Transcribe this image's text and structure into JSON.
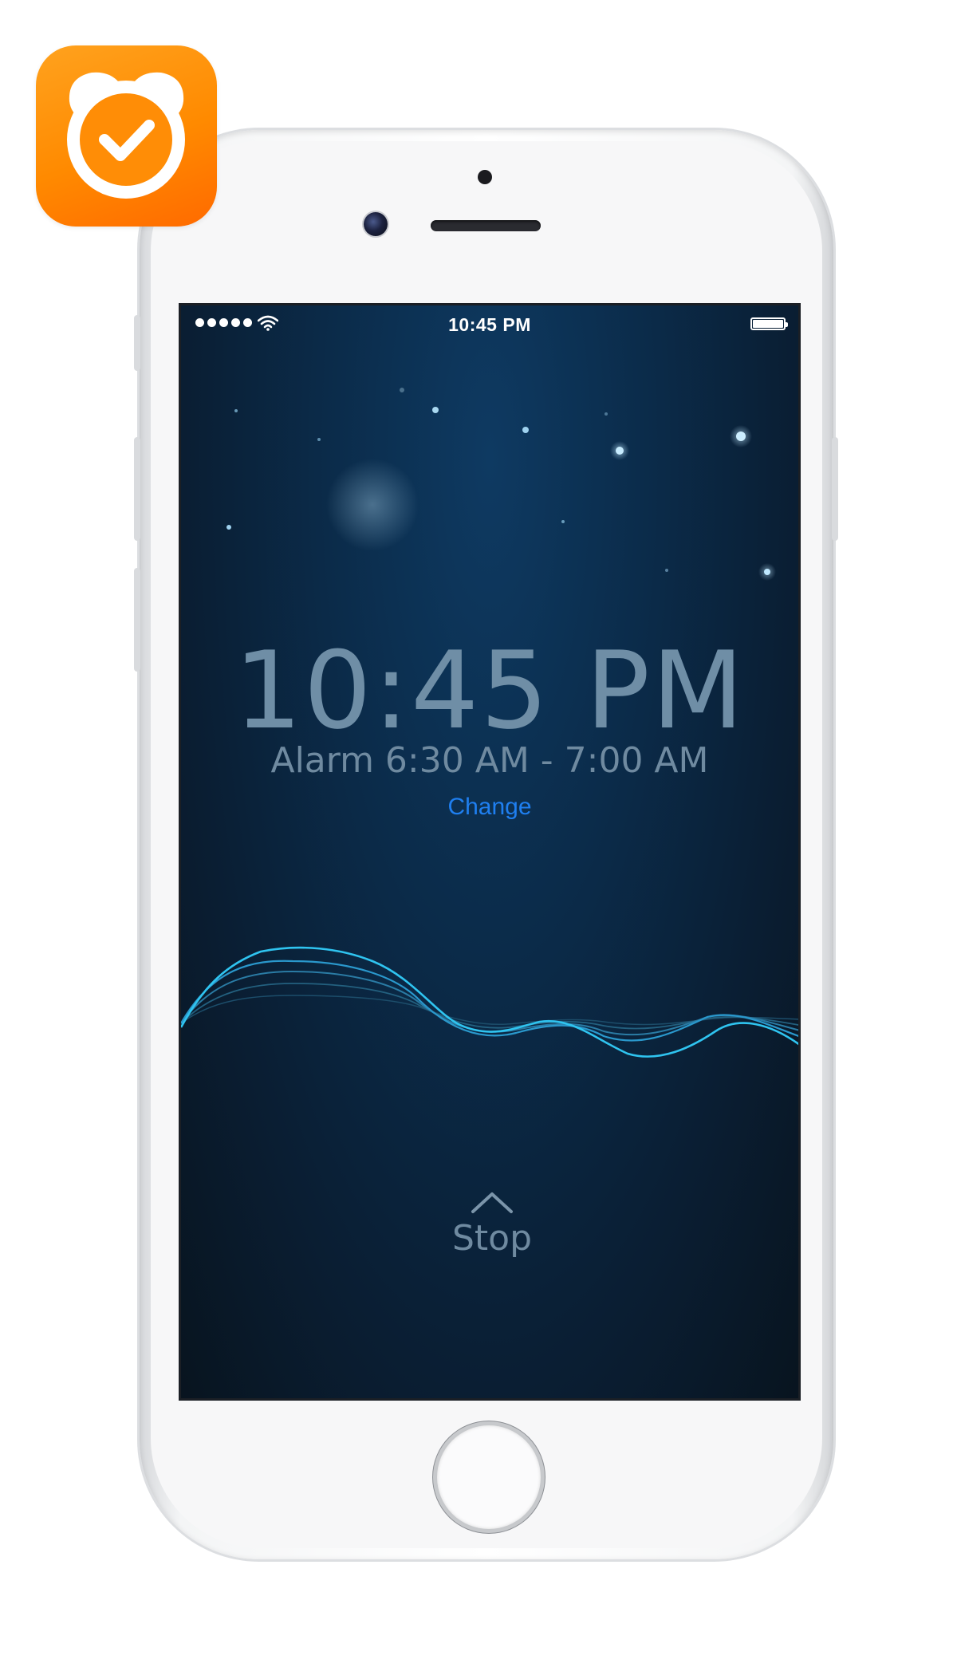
{
  "app_icon": {
    "name": "alarm-clock-check-icon",
    "color": "#ff8a00"
  },
  "status_bar": {
    "time": "10:45 PM",
    "signal_bars": 5,
    "wifi_icon": "wifi-icon",
    "battery_icon": "battery-icon"
  },
  "scene": {
    "moon_icon": "crescent-moon-icon",
    "stars_icon": "stars-icon"
  },
  "clock": {
    "time": "10:45 PM",
    "alarm": "Alarm 6:30 AM - 7:00 AM",
    "change_label": "Change"
  },
  "wave": {
    "icon": "sleep-wave-icon",
    "color": "#2fc4f0"
  },
  "stop": {
    "label": "Stop",
    "icon": "chevron-up-icon"
  },
  "colors": {
    "accent": "#1f7ff0",
    "text_muted": "#6f8aa0",
    "screen_bg": "#0b2c4b"
  }
}
